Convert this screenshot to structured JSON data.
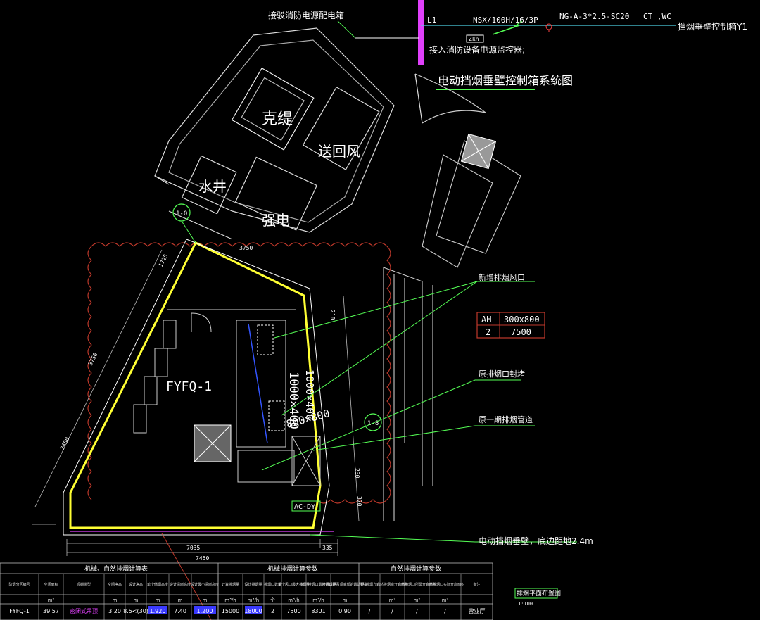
{
  "top": {
    "source_label": "接驳消防电源配电箱",
    "l1": "L1",
    "breaker": "NSX/100H/16/3P",
    "cable": "NG-A-3*2.5-SC20",
    "ct_wc": "CT ,WC",
    "target_box": "挡烟垂壁控制箱Y1",
    "zkn": "Zkn",
    "monitor": "接入消防设备电源监控器;",
    "system_title": "电动挡烟垂壁控制箱系统图"
  },
  "rooms": {
    "kedi": "克缇",
    "songhuifeng": "送回风",
    "shuijing": "水井",
    "qiangdian": "强电"
  },
  "zone": {
    "name": "FYFQ-1",
    "duct_size": "1000×400",
    "duct_size2": "1000×400",
    "duct_size3": "800×800",
    "marker": "AC-DY",
    "axis_top": "1-0",
    "axis_right": "1-8"
  },
  "callouts": {
    "new_smoke_outlet": "新增排烟风口",
    "ah": "AH",
    "ah_size": "300x800",
    "ah_qty": "2",
    "ah_flow": "7500",
    "orig_outlet_seal": "原排烟口封堵",
    "orig_duct": "原一期排烟管道",
    "curtain": "电动挡烟垂壁，底边距地2.4m"
  },
  "dims": {
    "bottom1": "7035",
    "bottom2": "335",
    "bottom3": "7450",
    "top_edge": "3750",
    "left_a": "1725",
    "left_b": "3750",
    "left_c": "2450",
    "small_a": "210",
    "small_b": "230",
    "small_c": "370"
  },
  "table": {
    "group1": "机械、自然排烟计算表",
    "group2": "机械排烟计算参数",
    "group3": "自然排烟计算参数",
    "headers": [
      "防烟分区编号",
      "空间面积",
      "顶棚类型",
      "空间净高",
      "设计净高",
      "单个储烟高度",
      "设计清晰高度",
      "设计最小清晰高度",
      "计算排烟量",
      "设计排烟量",
      "排烟口数量",
      "单个风口最大排烟量",
      "单个排烟口最大排烟量",
      "排烟口距吊顶底部的最近距离",
      "自然排烟方式",
      "自然排烟窗开启面积",
      "自然排烟口所需开启面积",
      "自然排烟口实际开启面积",
      "备注"
    ],
    "units": [
      "",
      "m²",
      "",
      "m",
      "m",
      "m",
      "m",
      "m",
      "m³/h",
      "m³/h",
      "个",
      "m³/h",
      "m³/h",
      "m",
      "",
      "m²",
      "m²",
      "m²",
      ""
    ],
    "row": [
      "FYFQ-1",
      "39.57",
      "密闭式吊顶",
      "3.20",
      "8.5<(30)",
      "1.920",
      "7.40",
      "1.200",
      "15000",
      "18000",
      "2",
      "7500",
      "8301",
      "0.90",
      "/",
      "/",
      "/",
      "/",
      "营业厅"
    ]
  },
  "legend": {
    "title": "排烟平面布置图",
    "scale": "1:100"
  }
}
